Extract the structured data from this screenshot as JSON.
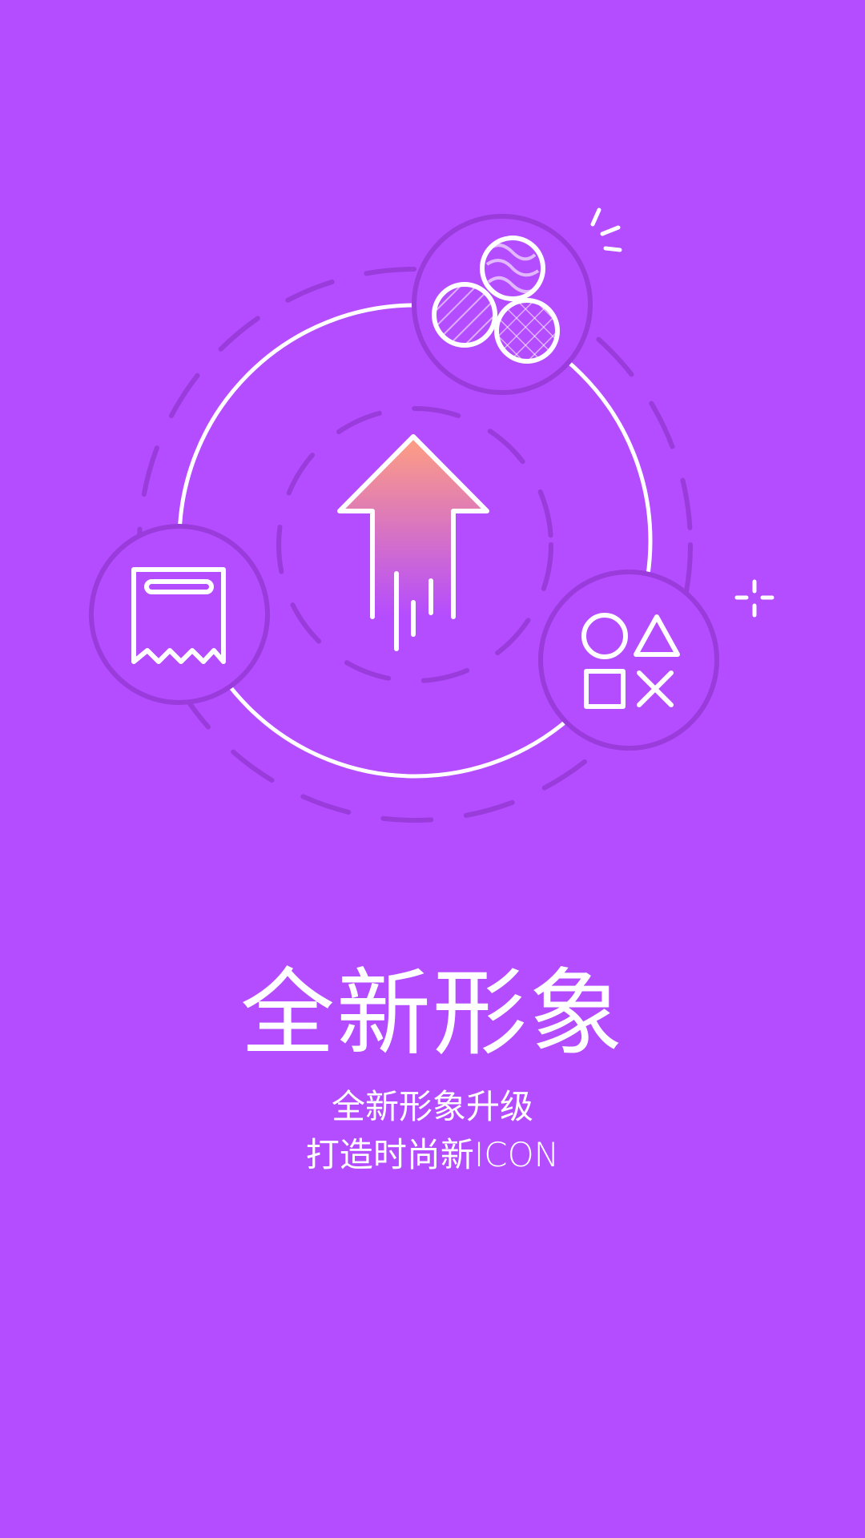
{
  "colors": {
    "background": "#b44cff",
    "line": "#ffffff",
    "dark_stroke": "#9a3bdc",
    "arrow_top": "#ff9f80",
    "arrow_bottom": "#b44cff"
  },
  "illustration": {
    "icons": [
      "upload-arrow-icon",
      "receipt-icon",
      "balls-icon",
      "game-symbols-icon",
      "sparkle-icon"
    ]
  },
  "text": {
    "title": "全新形象",
    "subtitle_line1": "全新形象升级",
    "subtitle_line2": "打造时尚新ICON"
  }
}
